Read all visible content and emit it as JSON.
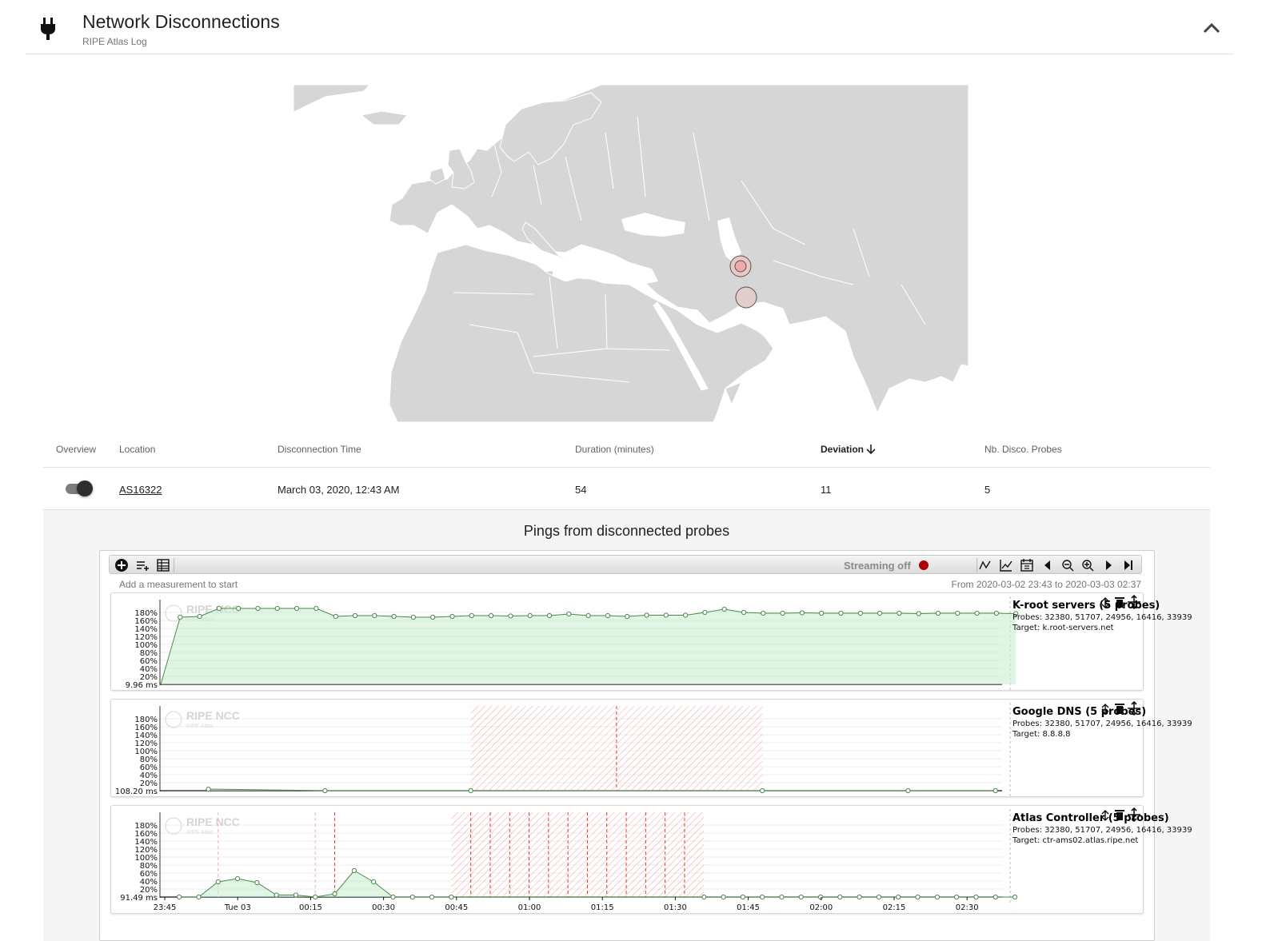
{
  "header": {
    "title": "Network Disconnections",
    "subtitle": "RIPE Atlas Log",
    "icon": "plug-icon",
    "collapse_icon": "chevron-up-icon"
  },
  "map": {
    "land_color": "#d6d6d6",
    "marker_color": "#f0b4b4",
    "markers": [
      {
        "label": "probe-cluster-1"
      },
      {
        "label": "probe-cluster-2"
      }
    ]
  },
  "table": {
    "columns": [
      "Overview",
      "Location",
      "Disconnection Time",
      "Duration (minutes)",
      "Deviation",
      "Nb. Disco. Probes"
    ],
    "sorted_column": "Deviation",
    "rows": [
      {
        "overview_on": true,
        "location": "AS16322",
        "time": "March 03, 2020, 12:43 AM",
        "duration": "54",
        "deviation": "11",
        "probes": "5"
      }
    ]
  },
  "panel": {
    "title": "Pings from disconnected probes",
    "streaming_label": "Streaming off",
    "streaming_color": "#b00000",
    "hint": "Add a measurement to start",
    "range": "From 2020-03-02 23:43 to 2020-03-03 02:37",
    "time_ticks": [
      "23:45",
      "Tue 03",
      "00:15",
      "00:30",
      "00:45",
      "01:00",
      "01:15",
      "01:30",
      "01:45",
      "02:00",
      "02:15",
      "02:30"
    ],
    "y_ticks": [
      "180%",
      "160%",
      "140%",
      "120%",
      "100%",
      "80%",
      "60%",
      "40%",
      "20%"
    ],
    "watermark": "RIPE NCC",
    "watermark_sub": "RIPE Atlas",
    "charts": [
      {
        "name": "K-root servers (5 probes)",
        "probes": "Probes: 32380, 51707, 24956, 16416, 33939",
        "target": "Target: k.root-servers.net",
        "baseline": "9.96 ms",
        "values": [
          0,
          168,
          170,
          190,
          190,
          190,
          190,
          190,
          190,
          170,
          172,
          172,
          170,
          168,
          168,
          170,
          172,
          172,
          171,
          172,
          172,
          176,
          172,
          172,
          170,
          173,
          173,
          173,
          180,
          188,
          180,
          178,
          178,
          179,
          178,
          178,
          178,
          178,
          178,
          177,
          178,
          178,
          178,
          178,
          177
        ]
      },
      {
        "name": "Google DNS (5 probes)",
        "probes": "Probes: 32380, 51707, 24956, 16416, 33939",
        "target": "Target: 8.8.8.8",
        "baseline": "108.20 ms",
        "points": [
          [
            2,
            4
          ],
          [
            8,
            0
          ],
          [
            15.5,
            0
          ],
          [
            30.5,
            0
          ],
          [
            38,
            0
          ],
          [
            42.5,
            0
          ]
        ],
        "outage_from": 15.5,
        "outage_to": 30.5
      },
      {
        "name": "Atlas Controller (5 probes)",
        "probes": "Probes: 32380, 51707, 24956, 16416, 33939",
        "target": "Target: ctr-ams02.atlas.ripe.net",
        "baseline": "91.49 ms",
        "points": [
          [
            0.5,
            0
          ],
          [
            1.5,
            0
          ],
          [
            2.5,
            38
          ],
          [
            3.5,
            46
          ],
          [
            4.5,
            36
          ],
          [
            5.5,
            5
          ],
          [
            6.5,
            5
          ],
          [
            7.5,
            0
          ],
          [
            8.5,
            8
          ],
          [
            9.5,
            66
          ],
          [
            10.5,
            38
          ],
          [
            11.5,
            0
          ],
          [
            12.5,
            0
          ],
          [
            13.5,
            0
          ],
          [
            14.5,
            0
          ],
          [
            27.5,
            0
          ],
          [
            28.5,
            0
          ],
          [
            29.5,
            0
          ],
          [
            30.5,
            0
          ],
          [
            31.5,
            0
          ],
          [
            32.5,
            0
          ],
          [
            33.5,
            0
          ],
          [
            34.5,
            0
          ],
          [
            35.5,
            0
          ],
          [
            36.5,
            0
          ],
          [
            37.5,
            0
          ],
          [
            38.5,
            0
          ],
          [
            39.5,
            0
          ],
          [
            40.5,
            0
          ],
          [
            41.5,
            0
          ],
          [
            42.5,
            0
          ],
          [
            43.5,
            0
          ]
        ],
        "outage_from": 14.5,
        "outage_to": 27.5
      }
    ]
  }
}
